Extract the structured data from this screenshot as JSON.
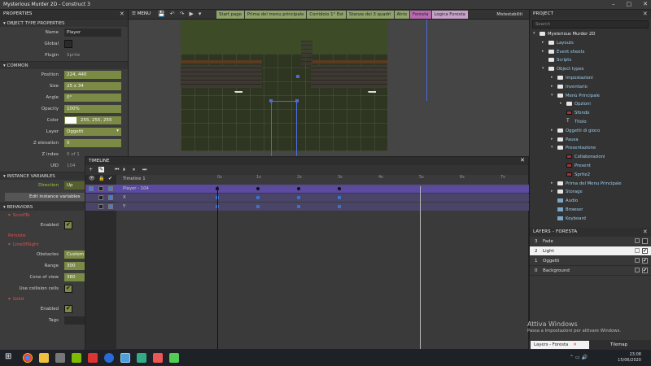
{
  "window": {
    "title": "Mysterious Murder 2D - Construct 3"
  },
  "properties": {
    "header": "PROPERTIES",
    "object_type_section": "OBJECT TYPE PROPERTIES",
    "name_label": "Name",
    "name_value": "Player",
    "global_label": "Global",
    "plugin_label": "Plugin",
    "plugin_value": "Sprite",
    "common_section": "COMMON",
    "position_label": "Position",
    "position_value": "224, 440",
    "size_label": "Size",
    "size_value": "25 x 34",
    "angle_label": "Angle",
    "angle_value": "0°",
    "opacity_label": "Opacity",
    "opacity_value": "100%",
    "color_label": "Color",
    "color_value": "255, 255, 255",
    "layer_label": "Layer",
    "layer_value": "Oggetti",
    "zelevation_label": "Z elevation",
    "zelevation_value": "0",
    "zindex_label": "Z index",
    "zindex_value": "0 of 1",
    "uid_label": "UID",
    "uid_value": "104",
    "instance_vars_section": "INSTANCE VARIABLES",
    "direction_label": "Direction",
    "direction_value": "Up",
    "edit_vars_button": "Edit instance variables",
    "behaviors_section": "BEHAVIORS",
    "behavior1": "ScrollTo",
    "enabled_label": "Enabled",
    "behavior2": "Persiste",
    "behavior3": "LineOfSight",
    "obstacles_label": "Obstacles",
    "obstacles_value": "Custom",
    "range_label": "Range",
    "range_value": "300",
    "cone_label": "Cone of view",
    "cone_value": "360",
    "collision_label": "Use collision cells",
    "behavior4": "Solid",
    "tags_label": "Tags"
  },
  "toolbar": {
    "menu_label": "MENU",
    "tabs": [
      {
        "label": "Start page",
        "color": "#8fa36a"
      },
      {
        "label": "Prima del menu principale",
        "color": "#8fa36a"
      },
      {
        "label": "Corridoio 1° Est",
        "color": "#8fa36a"
      },
      {
        "label": "Stanza dei 3 quadri",
        "color": "#8fa36a"
      },
      {
        "label": "Atrio",
        "color": "#8fa36a"
      },
      {
        "label": "Foresta",
        "color": "#b76ab0"
      },
      {
        "label": "Logica Foresta",
        "color": "#c6a2c8"
      }
    ],
    "user": "Mistestabiliti"
  },
  "timeline": {
    "header": "TIMELINE",
    "timeline_name": "Timeline 1",
    "tracks": [
      "Player - 104",
      "X",
      "Y"
    ],
    "ruler_ticks": [
      "0s",
      "1s",
      "2s",
      "3s",
      "4s",
      "5s",
      "6s",
      "7s"
    ]
  },
  "project": {
    "header": "PROJECT",
    "search_placeholder": "Search",
    "items": [
      {
        "label": "Mysterious Murder 2D",
        "indent": 0,
        "icon": "folder",
        "arrow": "▾",
        "dark": true
      },
      {
        "label": "Layouts",
        "indent": 1,
        "icon": "folder",
        "arrow": "▸"
      },
      {
        "label": "Event sheets",
        "indent": 1,
        "icon": "folder",
        "arrow": "▸"
      },
      {
        "label": "Scripts",
        "indent": 1,
        "icon": "folder",
        "arrow": ""
      },
      {
        "label": "Object types",
        "indent": 1,
        "icon": "folder",
        "arrow": "▾"
      },
      {
        "label": "Impostazioni",
        "indent": 2,
        "icon": "folder",
        "arrow": "▸"
      },
      {
        "label": "Inventario",
        "indent": 2,
        "icon": "folder",
        "arrow": "▸"
      },
      {
        "label": "Menù Principale",
        "indent": 2,
        "icon": "folder",
        "arrow": "▾"
      },
      {
        "label": "Opzioni",
        "indent": 3,
        "icon": "folder",
        "arrow": "▸"
      },
      {
        "label": "Sfondo",
        "indent": 3,
        "icon": "sprite",
        "arrow": ""
      },
      {
        "label": "Titolo",
        "indent": 3,
        "icon": "txt",
        "arrow": ""
      },
      {
        "label": "Oggetti di gioco",
        "indent": 2,
        "icon": "folder",
        "arrow": "▸"
      },
      {
        "label": "Pausa",
        "indent": 2,
        "icon": "folder",
        "arrow": "▸"
      },
      {
        "label": "Presentazione",
        "indent": 2,
        "icon": "folder",
        "arrow": "▾"
      },
      {
        "label": "Collaborazioni",
        "indent": 3,
        "icon": "sprite",
        "arrow": ""
      },
      {
        "label": "Present",
        "indent": 3,
        "icon": "sprite",
        "arrow": ""
      },
      {
        "label": "Sprite2",
        "indent": 3,
        "icon": "sprite",
        "arrow": ""
      },
      {
        "label": "Prima del Menu Principale",
        "indent": 2,
        "icon": "folder",
        "arrow": "▸"
      },
      {
        "label": "Storage",
        "indent": 2,
        "icon": "folder",
        "arrow": "▸"
      },
      {
        "label": "Audio",
        "indent": 2,
        "icon": "other",
        "arrow": ""
      },
      {
        "label": "Browser",
        "indent": 2,
        "icon": "other",
        "arrow": ""
      },
      {
        "label": "Keyboard",
        "indent": 2,
        "icon": "other",
        "arrow": ""
      }
    ]
  },
  "layers": {
    "header": "LAYERS - FORESTA",
    "items": [
      {
        "num": "3",
        "name": "Fade",
        "visible": false,
        "selected": false
      },
      {
        "num": "2",
        "name": "Light",
        "visible": true,
        "selected": true
      },
      {
        "num": "1",
        "name": "Oggetti",
        "visible": true,
        "selected": false
      },
      {
        "num": "0",
        "name": "Background",
        "visible": true,
        "selected": false
      }
    ]
  },
  "watermark": {
    "line1": "Attiva Windows",
    "line2": "Passa a Impostazioni per attivare Windows."
  },
  "bottom_tabs": {
    "tab1": "Layers - Foresta",
    "tab2": "Tilemap"
  },
  "taskbar": {
    "time": "23:08",
    "date": "15/06/2020"
  }
}
